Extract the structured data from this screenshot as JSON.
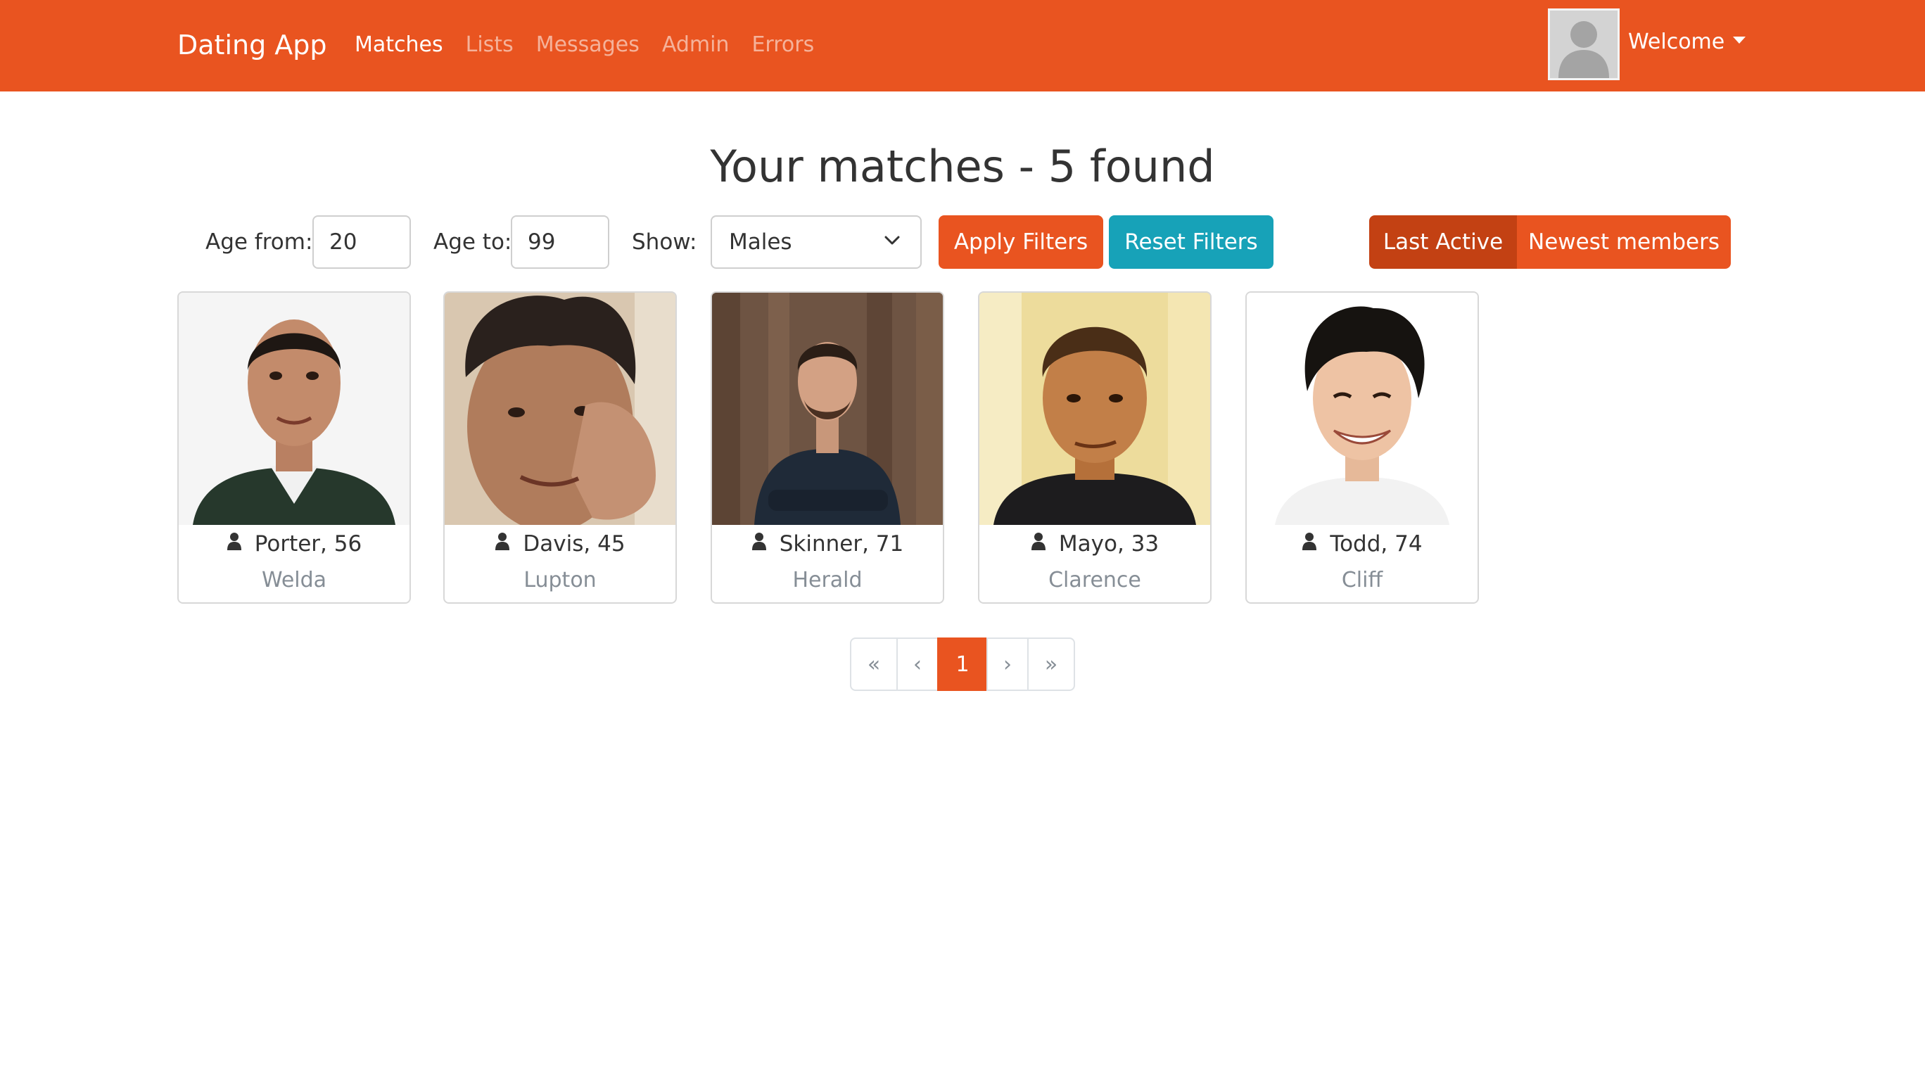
{
  "navbar": {
    "brand": "Dating App",
    "links": [
      {
        "label": "Matches",
        "active": true
      },
      {
        "label": "Lists",
        "active": false
      },
      {
        "label": "Messages",
        "active": false
      },
      {
        "label": "Admin",
        "active": false
      },
      {
        "label": "Errors",
        "active": false
      }
    ],
    "user_menu": {
      "label": "Welcome",
      "avatar": "default-user-avatar"
    }
  },
  "page": {
    "title": "Your matches - 5 found"
  },
  "filters": {
    "age_from_label": "Age from:",
    "age_from_value": "20",
    "age_to_label": "Age to:",
    "age_to_value": "99",
    "show_label": "Show:",
    "show_selected": "Males",
    "apply_label": "Apply Filters",
    "reset_label": "Reset Filters"
  },
  "sort": {
    "options": [
      {
        "label": "Last Active",
        "active": true
      },
      {
        "label": "Newest members",
        "active": false
      }
    ]
  },
  "members": [
    {
      "name": "Porter, 56",
      "city": "Welda"
    },
    {
      "name": "Davis, 45",
      "city": "Lupton"
    },
    {
      "name": "Skinner, 71",
      "city": "Herald"
    },
    {
      "name": "Mayo, 33",
      "city": "Clarence"
    },
    {
      "name": "Todd, 74",
      "city": "Cliff"
    }
  ],
  "pagination": {
    "first": "«",
    "prev": "‹",
    "current": "1",
    "next": "›",
    "last": "»"
  },
  "colors": {
    "primary": "#e95420",
    "primary_dark": "#c34113",
    "info": "#17a2b8",
    "muted": "#868e96"
  },
  "icons": {
    "user": "user-icon",
    "dropdown": "chevron-down-icon"
  }
}
